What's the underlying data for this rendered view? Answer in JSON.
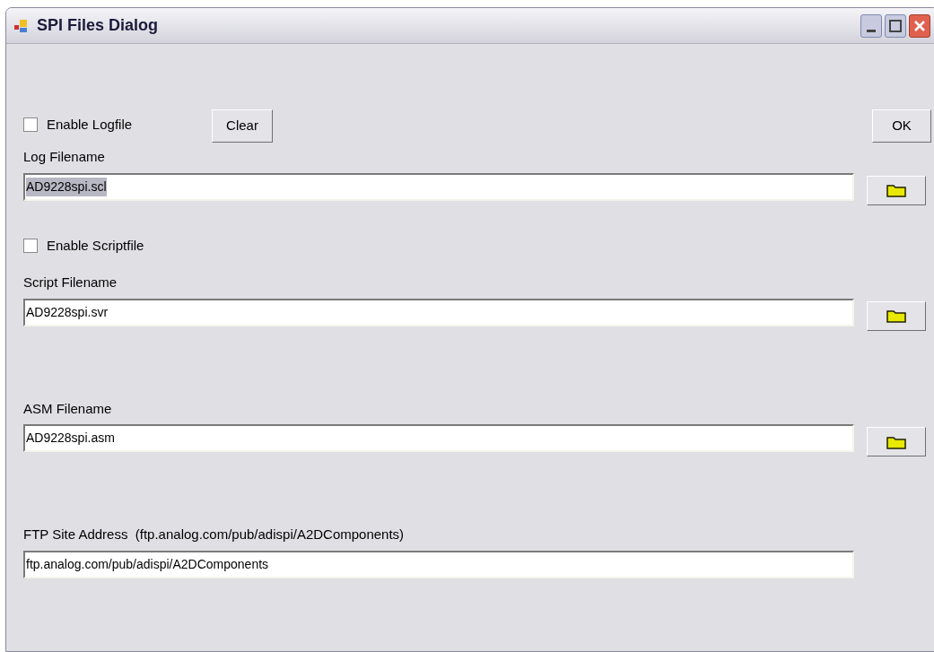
{
  "window": {
    "title": "SPI Files Dialog"
  },
  "log_checkbox": {
    "label": "Enable Logfile",
    "checked": false
  },
  "clear_button": "Clear",
  "ok_button": "OK",
  "log_field": {
    "label": "Log Filename",
    "value": "AD9228spi.scl",
    "text_selected": true,
    "browse": true
  },
  "script_checkbox": {
    "label": "Enable Scriptfile",
    "checked": false
  },
  "script_field": {
    "label": "Script Filename",
    "value": "AD9228spi.svr",
    "text_selected": false,
    "browse": true
  },
  "asm_field": {
    "label": "ASM Filename",
    "value": "AD9228spi.asm",
    "text_selected": false,
    "browse": true
  },
  "ftp_field": {
    "label": "FTP Site Address  (ftp.analog.com/pub/adispi/A2DComponents)",
    "value": "ftp.analog.com/pub/adispi/A2DComponents",
    "text_selected": false,
    "browse": false
  }
}
